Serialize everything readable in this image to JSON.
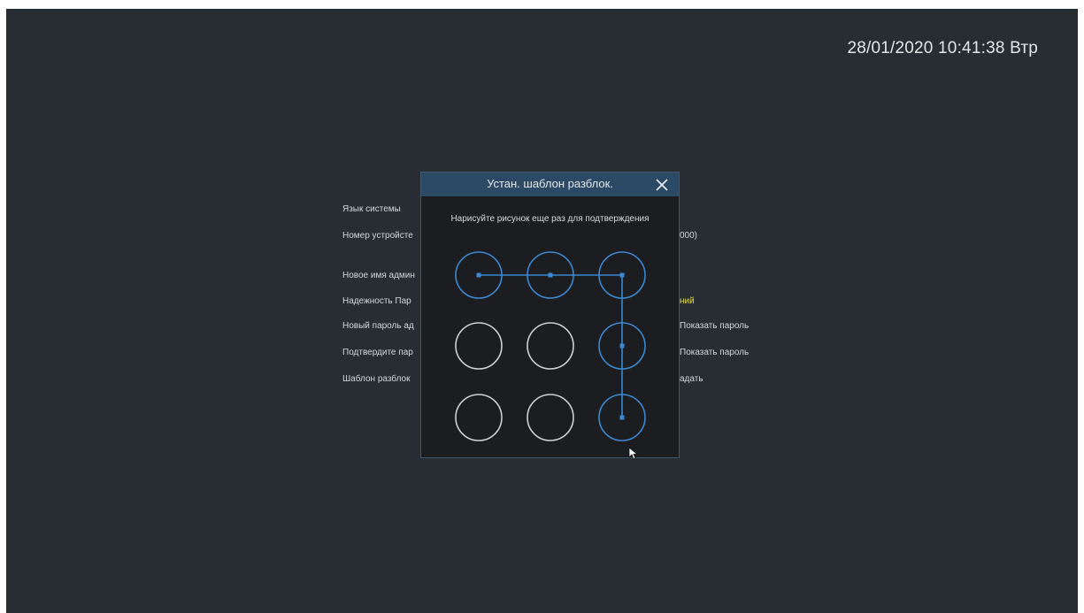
{
  "clock": {
    "datetime": "28/01/2020 10:41:38 Втр"
  },
  "background_form": {
    "labels": [
      "Язык системы",
      "Номер устройсте",
      "Новое имя админ",
      "Надежность Пар",
      "Новый пароль ад",
      "Подтвердите пар",
      "Шаблон разблок"
    ],
    "right_values": {
      "device_number_suffix": "000)",
      "strength_suffix": "ний",
      "show_password_1": "Показать пароль",
      "show_password_2": "Показать пароль",
      "pattern_set": "адать"
    }
  },
  "dialog": {
    "title": "Устан. шаблон разблок.",
    "instruction": "Нарисуйте рисунок еще раз для подтверждения",
    "pattern": {
      "rows": 3,
      "cols": 3,
      "selected_sequence": [
        1,
        2,
        3,
        6,
        9
      ]
    }
  },
  "colors": {
    "background": "#282d34",
    "dialog_header": "#2c4a66",
    "dialog_body": "#1b1d21",
    "node_selected": "#3b89d1",
    "node_unselected": "#d0d0d0",
    "strength_text": "#e6de3b"
  }
}
